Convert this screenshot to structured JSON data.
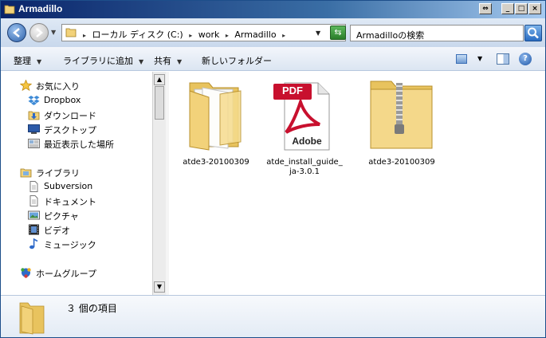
{
  "window": {
    "title": "Armadillo"
  },
  "title_buttons": {
    "restore": "⇔",
    "minimize": "_",
    "maximize": "□",
    "close": "×"
  },
  "address": {
    "crumbs": [
      "ローカル ディスク (C:)",
      "work",
      "Armadillo"
    ]
  },
  "search": {
    "placeholder": "Armadilloの検索"
  },
  "toolbar": {
    "organize": "整理",
    "add_to_library": "ライブラリに追加",
    "share": "共有",
    "new_folder": "新しいフォルダー"
  },
  "nav": {
    "favorites": {
      "header": "お気に入り",
      "items": [
        {
          "label": "Dropbox",
          "icon": "dropbox-icon"
        },
        {
          "label": "ダウンロード",
          "icon": "downloads-icon"
        },
        {
          "label": "デスクトップ",
          "icon": "desktop-icon"
        },
        {
          "label": "最近表示した場所",
          "icon": "recent-places-icon"
        }
      ]
    },
    "libraries": {
      "header": "ライブラリ",
      "items": [
        {
          "label": "Subversion",
          "icon": "document-icon"
        },
        {
          "label": "ドキュメント",
          "icon": "document-icon"
        },
        {
          "label": "ピクチャ",
          "icon": "pictures-icon"
        },
        {
          "label": "ビデオ",
          "icon": "video-icon"
        },
        {
          "label": "ミュージック",
          "icon": "music-icon"
        }
      ]
    },
    "homegroup": {
      "label": "ホームグループ",
      "icon": "homegroup-icon"
    }
  },
  "files": [
    {
      "label": "atde3-20100309",
      "icon": "folder-icon"
    },
    {
      "label": "atde_install_guide_\nja-3.0.1",
      "icon": "pdf-icon",
      "badge": "PDF",
      "brand": "Adobe"
    },
    {
      "label": "atde3-20100309",
      "icon": "zip-folder-icon"
    }
  ],
  "status": {
    "item_count": "３ 個の項目"
  },
  "colors": {
    "titlebar": "#0a246a",
    "folder": "#f2d27a",
    "pdf_red": "#c8102e"
  }
}
